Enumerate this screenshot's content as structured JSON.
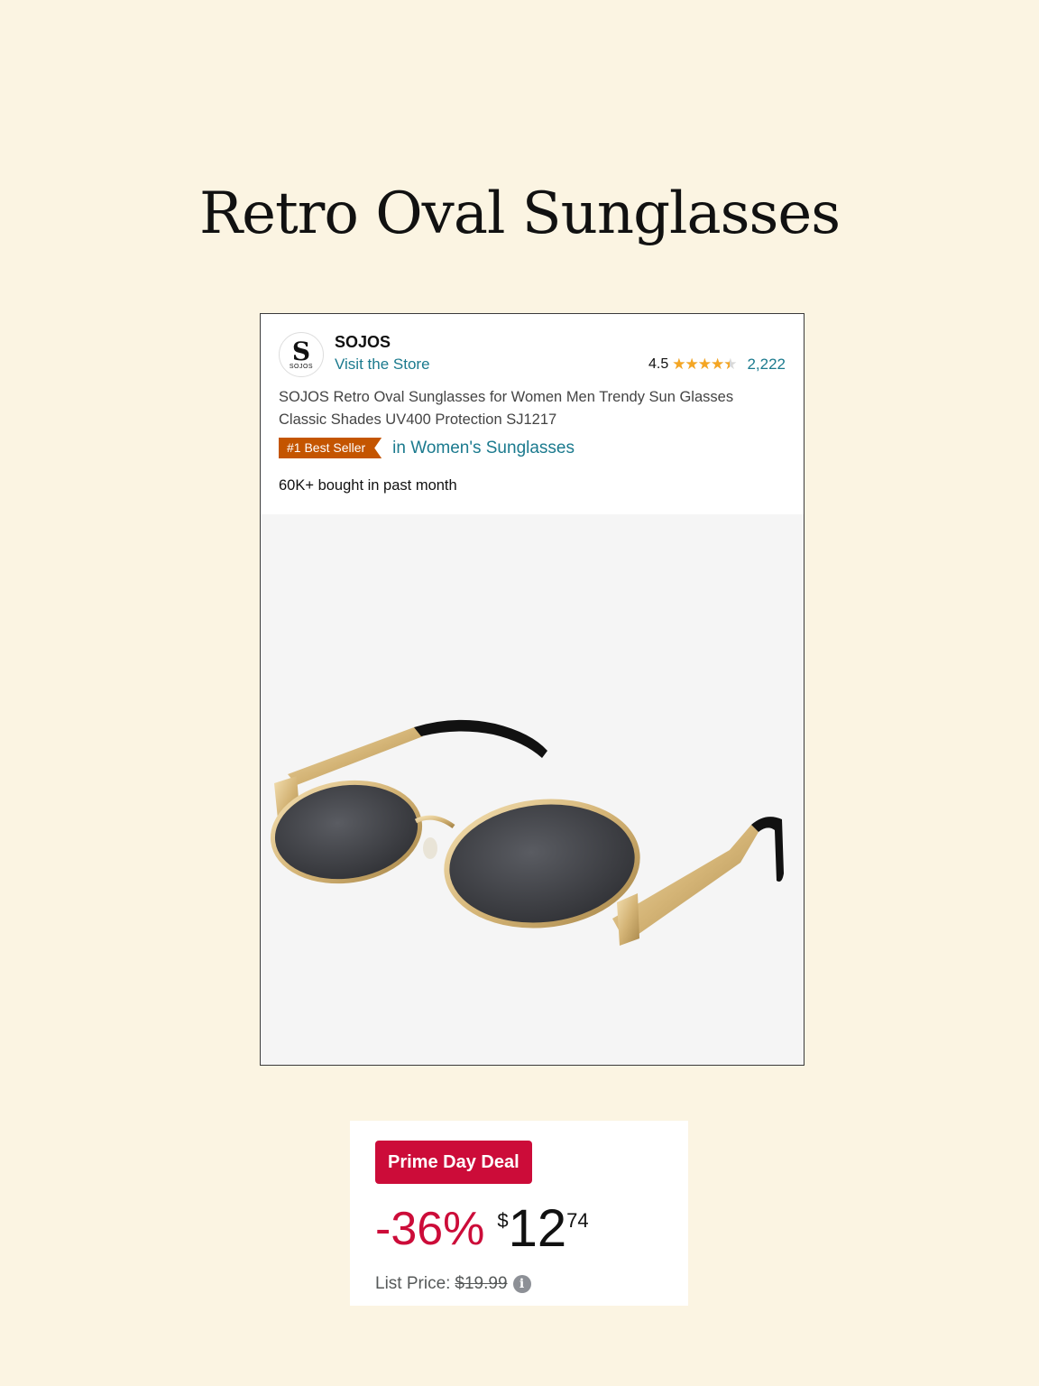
{
  "page_title": "Retro Oval Sunglasses",
  "product": {
    "logo_mark": "S",
    "logo_text": "SOJOS",
    "brand": "SOJOS",
    "visit_store": "Visit the Store",
    "rating": "4.5",
    "rating_fraction": 0.9,
    "stars": "★★★★★",
    "review_count": "2,222",
    "title": "SOJOS Retro Oval Sunglasses for Women Men Trendy Sun Glasses Classic Shades UV400 Protection SJ1217",
    "badge": "#1 Best Seller",
    "badge_category": "in Women's Sunglasses",
    "bought": "60K+ bought in past month"
  },
  "deal": {
    "badge": "Prime Day Deal",
    "discount": "-36%",
    "currency": "$",
    "price_whole": "12",
    "price_fraction": "74",
    "list_label": "List Price:",
    "list_price": "$19.99",
    "info_icon": "i"
  },
  "colors": {
    "background": "#fbf4e2",
    "link": "#1b7a8e",
    "badge_orange": "#c45500",
    "deal_red": "#cc0c39",
    "star": "#f5a623"
  }
}
